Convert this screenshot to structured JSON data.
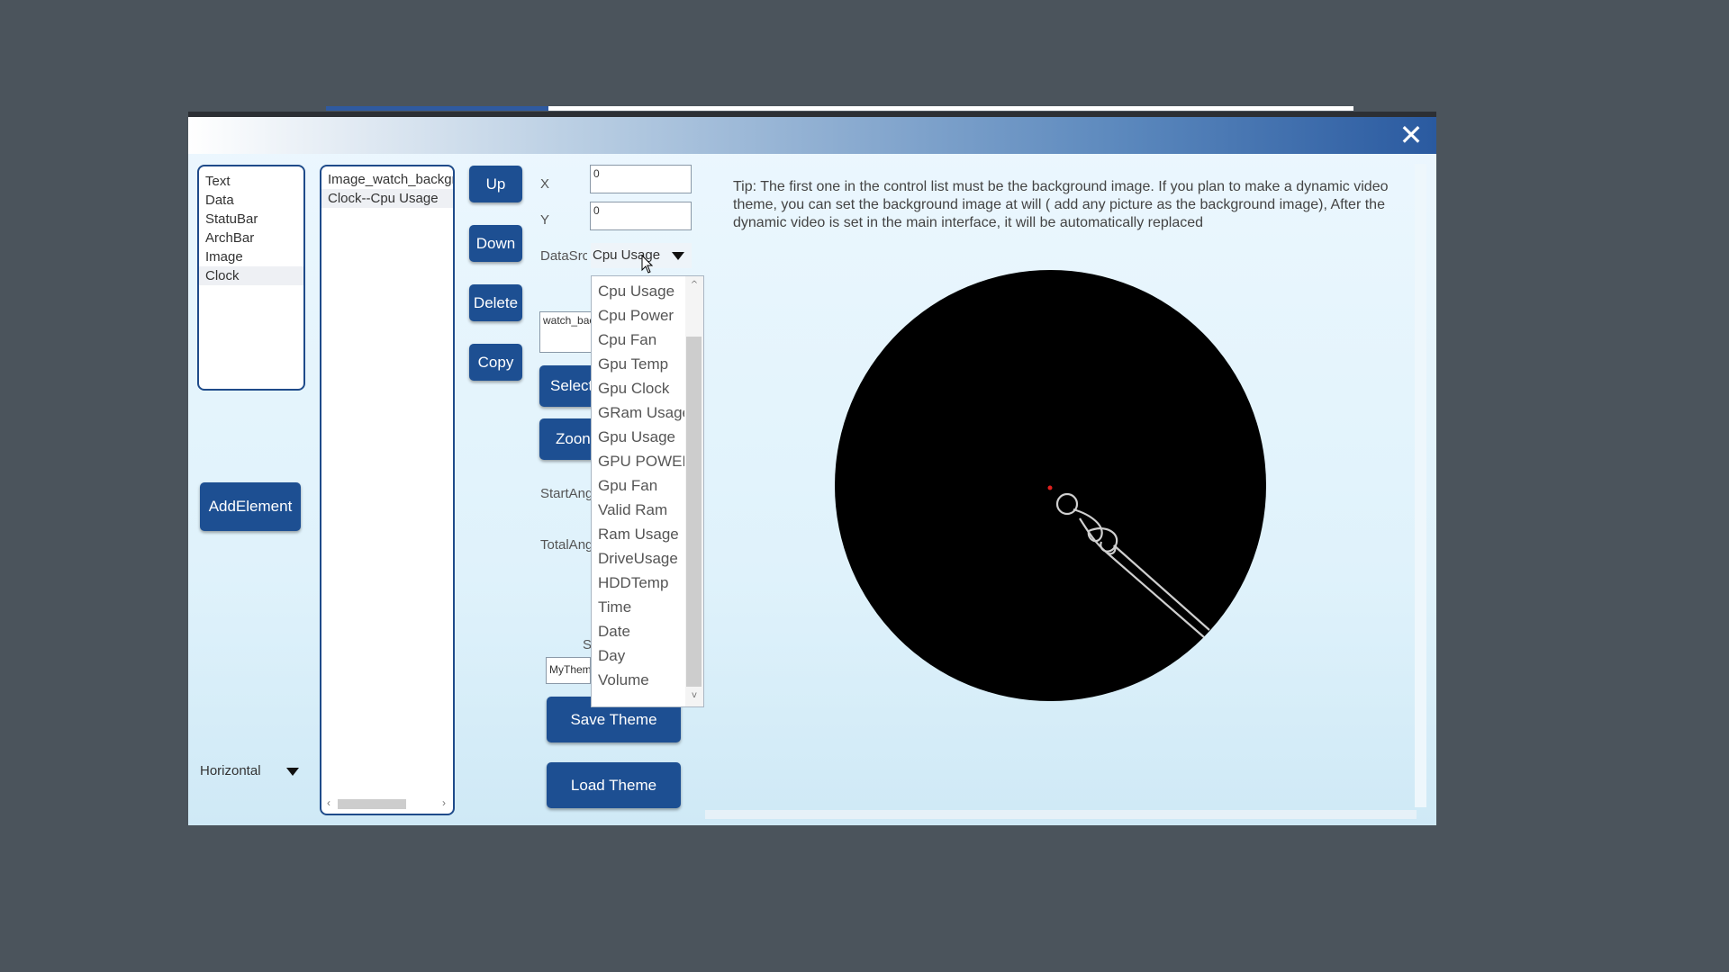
{
  "window": {
    "close_glyph": "✕"
  },
  "element_types": {
    "items": [
      "Text",
      "Data",
      "StatuBar",
      "ArchBar",
      "Image",
      "Clock"
    ],
    "selected": "Clock"
  },
  "add_element_label": "AddElement",
  "orientation": {
    "value": "Horizontal"
  },
  "controls": {
    "items": [
      "Image_watch_backgrc",
      "Clock--Cpu Usage"
    ]
  },
  "actions": {
    "up": "Up",
    "down": "Down",
    "delete": "Delete",
    "copy": "Copy"
  },
  "props": {
    "x_label": "X",
    "x_value": "0",
    "y_label": "Y",
    "y_value": "0",
    "datasrc_label": "DataSrc",
    "datasrc_value": "Cpu Usage",
    "image_field": "watch_bac",
    "select_image_label": "Select I",
    "zoom_label": "Zoon",
    "start_angle_label": "StartAng",
    "total_angle_label": "TotalAng",
    "s_label": "S",
    "theme_name": "MyThem"
  },
  "theme_buttons": {
    "save": "Save Theme",
    "load": "Load Theme"
  },
  "dropdown": {
    "options": [
      "Cpu Usage",
      "Cpu Power",
      "Cpu Fan",
      "Gpu Temp",
      "Gpu Clock",
      "GRam Usage",
      "Gpu Usage",
      "GPU POWER",
      "Gpu Fan",
      "Valid Ram",
      "Ram Usage",
      "DriveUsage",
      "HDDTemp",
      "Time",
      "Date",
      "Day",
      "Volume"
    ],
    "scroll_up_glyph": "^",
    "scroll_down_glyph": "v"
  },
  "tip": {
    "text": "Tip: The first one in the control list must be the background image. If you plan to make a dynamic video theme, you can set the background image at will ( add any picture as the background image), After the dynamic video is set in the main interface, it will be automatically replaced"
  },
  "colors": {
    "button_bg": "#1d4f92",
    "accent_border": "#1f4b8a",
    "preview_bg": "#000000",
    "center_dot": "#e0201e"
  },
  "icons": {
    "close": "close-icon",
    "dropdown_arrow": "triangle-down-icon",
    "cursor": "mouse-pointer-icon",
    "clock_hand": "clock-hand-icon"
  }
}
